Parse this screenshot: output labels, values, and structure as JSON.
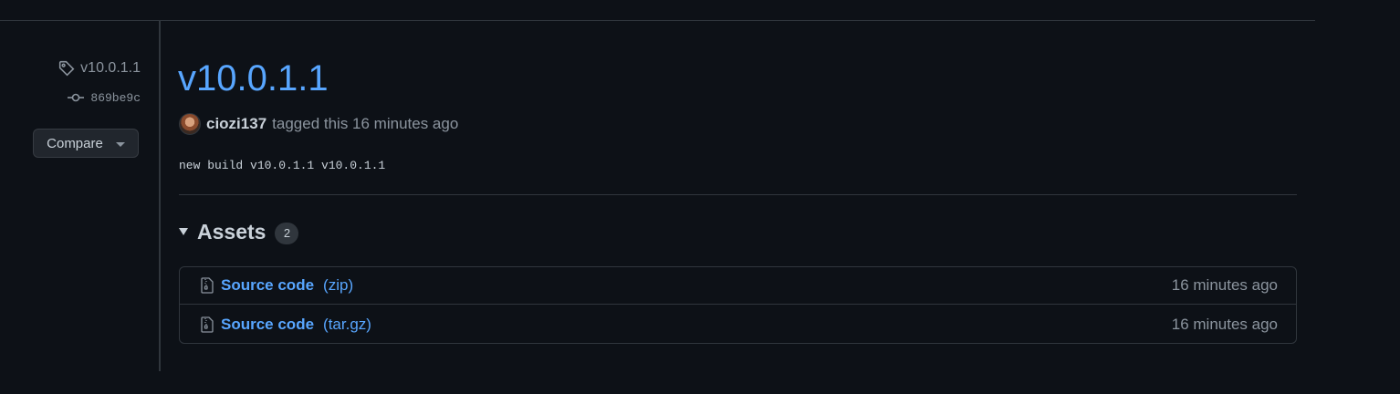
{
  "sidebar": {
    "tag_name": "v10.0.1.1",
    "commit_sha": "869be9c",
    "compare_label": "Compare"
  },
  "release": {
    "title": "v10.0.1.1",
    "author": "ciozi137",
    "tagged_text": "tagged this 16 minutes ago",
    "body": "new build v10.0.1.1 v10.0.1.1"
  },
  "assets": {
    "label": "Assets",
    "count": "2",
    "items": [
      {
        "name": "Source code",
        "ext": "(zip)",
        "time": "16 minutes ago"
      },
      {
        "name": "Source code",
        "ext": "(tar.gz)",
        "time": "16 minutes ago"
      }
    ]
  },
  "icons": {
    "tag": "tag-icon",
    "commit": "git-commit-icon",
    "file_zip": "file-zip-icon",
    "caret": "triangle-down-icon"
  },
  "colors": {
    "background": "#0d1117",
    "link": "#58a6ff",
    "muted": "#8b949e",
    "border": "#30363d"
  }
}
